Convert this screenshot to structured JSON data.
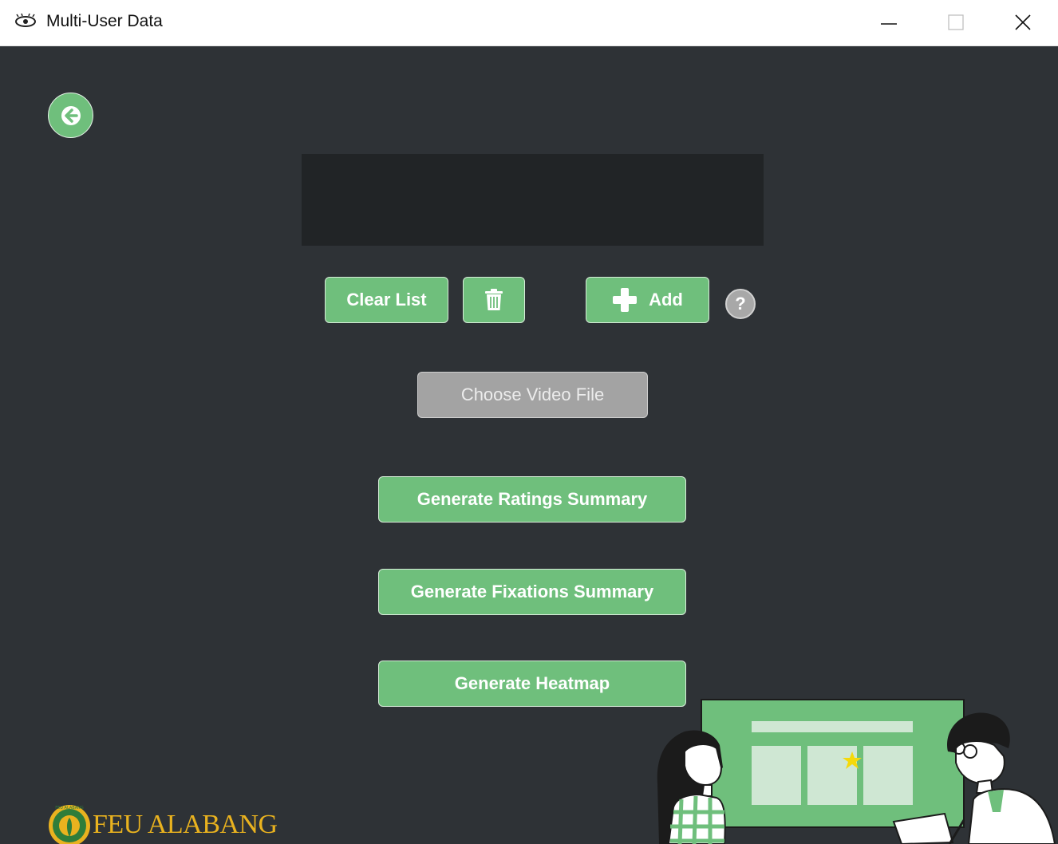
{
  "window": {
    "title": "Multi-User Data",
    "minimize_icon": "minimize-icon",
    "maximize_icon": "maximize-icon",
    "close_icon": "close-icon"
  },
  "back_button": {
    "icon": "arrow-left-icon"
  },
  "toolbar": {
    "clear_label": "Clear List",
    "delete_icon": "trash-icon",
    "add_label": "Add",
    "add_icon": "plus-icon",
    "help_label": "?"
  },
  "actions": {
    "choose_video": "Choose Video File",
    "ratings": "Generate Ratings Summary",
    "fixations": "Generate Fixations Summary",
    "heatmap": "Generate Heatmap"
  },
  "footer": {
    "logo_text": "FEU ALABANG",
    "seal_text": "FEU ALABANG"
  },
  "colors": {
    "background": "#2e3236",
    "list_bg": "#212426",
    "accent": "#6fbf7c",
    "disabled": "#a3a3a3",
    "logo": "#e9b21f"
  }
}
